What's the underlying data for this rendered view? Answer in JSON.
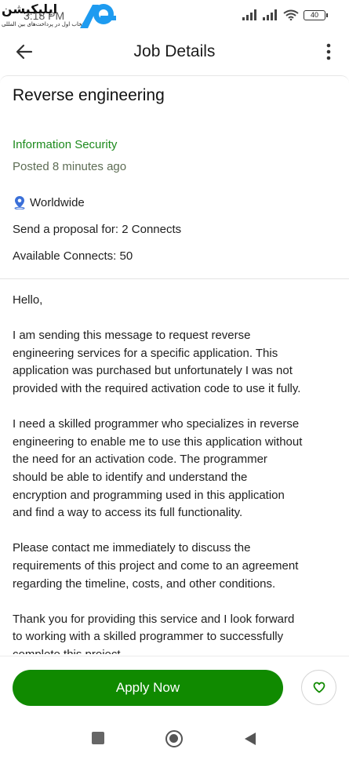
{
  "status_bar": {
    "time": "3:18 PM",
    "battery": "40",
    "watermark_text": "اپلیکیشن",
    "watermark_sub": "انتخاب اول در پرداخت‌های بین المللی",
    "icons": [
      "signal-icon",
      "signal-icon",
      "wifi-icon",
      "battery-icon"
    ]
  },
  "header": {
    "title": "Job Details",
    "back_icon": "arrow-left-icon",
    "more_icon": "more-vertical-icon"
  },
  "job": {
    "title": "Reverse engineering",
    "category": "Information Security",
    "posted": "Posted 8 minutes ago",
    "location": "Worldwide",
    "proposal": "Send a proposal for: 2 Connects",
    "available": "Available Connects: 50"
  },
  "description": {
    "lines": [
      "Hello,",
      "I am sending this message to request reverse",
      "engineering services for a specific application. This",
      "application was purchased but unfortunately I was not",
      "provided with the required activation code to use it fully.",
      "I need a skilled programmer who specializes in reverse",
      "engineering to enable me to use this application without",
      "the need for an activation code. The programmer",
      "should be able to identify and understand the",
      "encryption and programming used in this application",
      "and find a way to access its full functionality.",
      "Please contact me immediately to discuss the",
      "requirements of this project and come to an agreement",
      "regarding the timeline, costs, and other conditions.",
      "Thank you for providing this service and I look forward",
      "to working with a skilled programmer to successfully",
      "complete this project."
    ]
  },
  "actions": {
    "apply_label": "Apply Now",
    "favorite_icon": "heart-icon"
  },
  "colors": {
    "accent_green": "#108a00",
    "category_green": "#1d8a1d",
    "location_pin": "#3a6fd8"
  }
}
